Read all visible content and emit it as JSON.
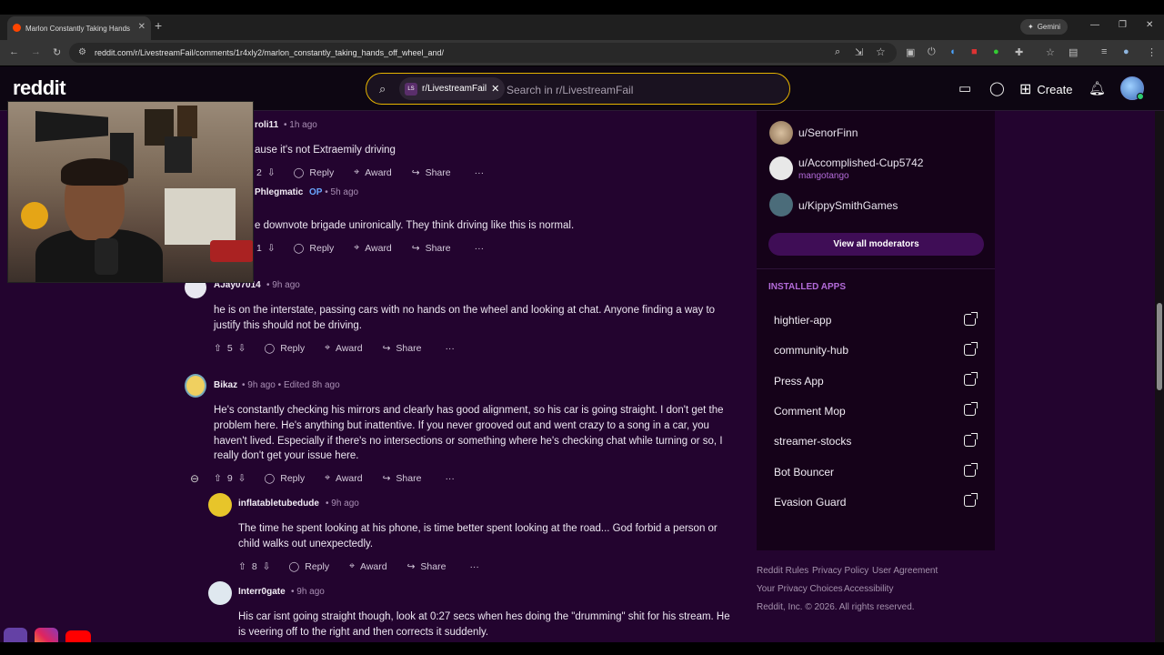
{
  "browser": {
    "tab_title": "Marlon Constantly Taking Hands",
    "url": "reddit.com/r/LivestreamFail/comments/1r4xly2/marlon_constantly_taking_hands_off_wheel_and/",
    "gemini_label": "Gemini"
  },
  "header": {
    "logo": "reddit",
    "search_chip": "r/LivestreamFail",
    "search_chip_icon": "LS",
    "search_placeholder": "Search in r/LivestreamFail",
    "create_label": "Create"
  },
  "comments": [
    {
      "user": "roli11",
      "time": "1h ago",
      "body": "ause it's not Extraemily driving",
      "votes": "2",
      "reply": "Reply",
      "award": "Award",
      "share": "Share"
    },
    {
      "user": "Phlegmatic",
      "op": "OP",
      "time": "5h ago",
      "body": "e downvote brigade unironically. They think driving like this is normal.",
      "votes": "1",
      "reply": "Reply",
      "award": "Award",
      "share": "Share"
    },
    {
      "user": "AJay07014",
      "time": "9h ago",
      "body": "he is on the interstate, passing cars with no hands on the wheel and looking at chat. Anyone finding a way to justify this should not be driving.",
      "votes": "5",
      "reply": "Reply",
      "award": "Award",
      "share": "Share"
    },
    {
      "user": "Bikaz",
      "time": "9h ago",
      "edited": "Edited 8h ago",
      "body": "He's constantly checking his mirrors and clearly has good alignment, so his car is going straight. I don't get the problem here. He's anything but inattentive. If you never grooved out and went crazy to a song in a car, you haven't lived. Especially if there's no intersections or something where he's checking chat while turning or so, I really don't get your issue here.",
      "votes": "9",
      "reply": "Reply",
      "award": "Award",
      "share": "Share"
    },
    {
      "user": "inflatabletubedude",
      "time": "9h ago",
      "body": "The time he spent looking at his phone, is time better spent looking at the road... God forbid a person or child walks out unexpectedly.",
      "votes": "8",
      "reply": "Reply",
      "award": "Award",
      "share": "Share"
    },
    {
      "user": "Interr0gate",
      "time": "9h ago",
      "body": "His car isnt going straight though, look at 0:27 secs when hes doing the \"drumming\" shit for his stream. He is veering off to the right and then corrects it suddenly."
    }
  ],
  "sidebar": {
    "moderators": [
      {
        "name": "u/SenorFinn",
        "flair": ""
      },
      {
        "name": "u/Accomplished-Cup5742",
        "flair": "mangotango"
      },
      {
        "name": "u/KippySmithGames",
        "flair": ""
      }
    ],
    "view_all_mods": "View all moderators",
    "apps_title": "INSTALLED APPS",
    "apps": [
      "hightier-app",
      "community-hub",
      "Press App",
      "Comment Mop",
      "streamer-stocks",
      "Bot Bouncer",
      "Evasion Guard"
    ]
  },
  "footer": {
    "links": [
      "Reddit Rules",
      "Privacy Policy",
      "User Agreement",
      "Your Privacy Choices",
      "Accessibility"
    ],
    "copyright": "Reddit, Inc. © 2026. All rights reserved."
  },
  "colors": {
    "page_bg": "#23042f",
    "sidebar_bg": "#150219",
    "accent": "#b36bd9",
    "op": "#6aa6ff"
  }
}
